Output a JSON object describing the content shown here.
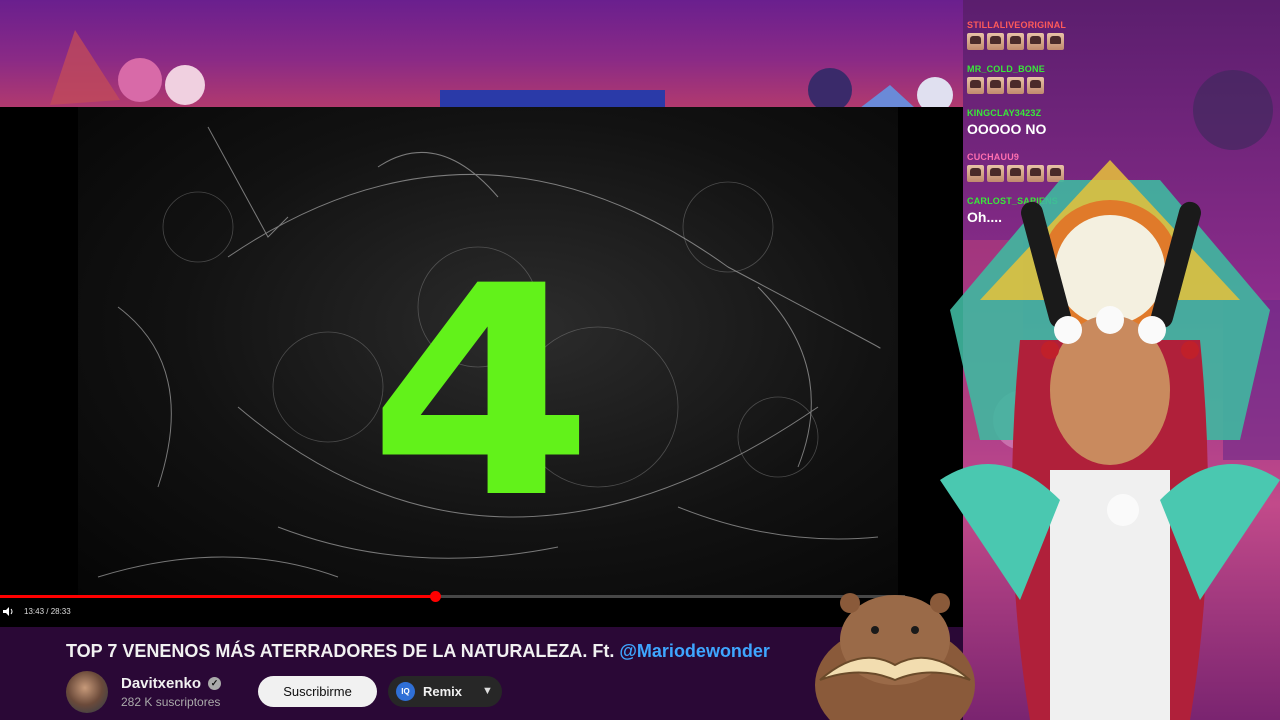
{
  "player": {
    "current_time": "13:43",
    "duration": "28:33",
    "time_display": "13:43 / 28:33",
    "progress_fraction": 0.4806,
    "overlay_number": "4"
  },
  "video": {
    "title": "TOP 7 VENENOS MÁS ATERRADORES DE LA NATURALEZA. Ft. ",
    "title_mention": "@Mariodewonder"
  },
  "channel": {
    "name": "Davitxenko",
    "subscribers": "282 K suscriptores"
  },
  "actions": {
    "subscribe_label": "Suscribirme",
    "remix_label": "Remix",
    "remix_icon_text": "IQ"
  },
  "chat": {
    "messages": [
      {
        "user": "STILLALIVEORIGINAL",
        "user_color": "#ff5a5a",
        "emotes": 5
      },
      {
        "user": "MR_COLD_BONE",
        "user_color": "#39e83a",
        "emotes": 4
      },
      {
        "user": "KINGCLAY3423Z",
        "user_color": "#39e83a",
        "text": "OOOOO NO"
      },
      {
        "user": "CUCHAUU9",
        "user_color": "#ff6fb0",
        "emotes": 5
      },
      {
        "user": "CARLOST_SAPIENS",
        "user_color": "#39e83a",
        "text": "Oh...."
      }
    ]
  },
  "colors": {
    "accent_red": "#ff0000",
    "overlay_green": "#62f21a",
    "mention_blue": "#3ea6ff"
  }
}
